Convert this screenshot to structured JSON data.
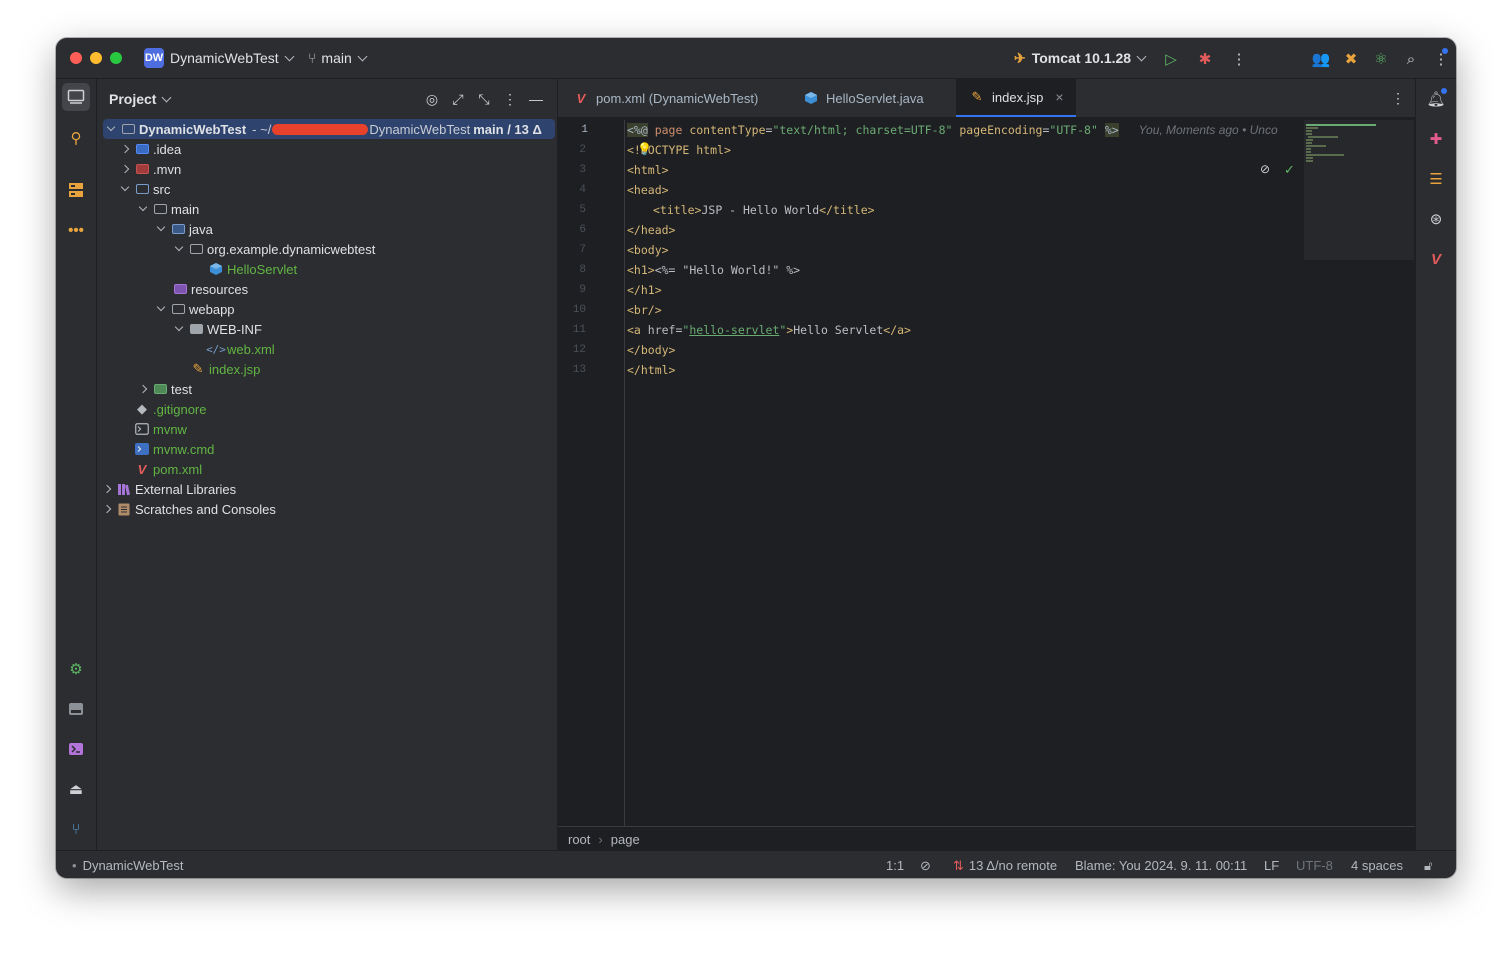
{
  "titlebar": {
    "project_badge": "DW",
    "project_name": "DynamicWebTest",
    "branch": "main",
    "run_config": "Tomcat 10.1.28"
  },
  "project_panel": {
    "title": "Project",
    "root": {
      "name": "DynamicWebTest",
      "path_prefix": "- ~/",
      "path_suffix": "DynamicWebTest",
      "vcs": "main / 13 Δ"
    },
    "items": [
      {
        "label": ".idea"
      },
      {
        "label": ".mvn"
      },
      {
        "label": "src"
      },
      {
        "label": "main"
      },
      {
        "label": "java"
      },
      {
        "label": "org.example.dynamicwebtest"
      },
      {
        "label": "HelloServlet"
      },
      {
        "label": "resources"
      },
      {
        "label": "webapp"
      },
      {
        "label": "WEB-INF"
      },
      {
        "label": "web.xml"
      },
      {
        "label": "index.jsp"
      },
      {
        "label": "test"
      },
      {
        "label": ".gitignore"
      },
      {
        "label": "mvnw"
      },
      {
        "label": "mvnw.cmd"
      },
      {
        "label": "pom.xml"
      },
      {
        "label": "External Libraries"
      },
      {
        "label": "Scratches and Consoles"
      }
    ]
  },
  "tabs": [
    {
      "label": "pom.xml (DynamicWebTest)"
    },
    {
      "label": "HelloServlet.java"
    },
    {
      "label": "index.jsp",
      "close": "×"
    }
  ],
  "editor": {
    "line_numbers": [
      "1",
      "2",
      "3",
      "4",
      "5",
      "6",
      "7",
      "8",
      "9",
      "10",
      "11",
      "12",
      "13"
    ],
    "line1": {
      "open": "<%@",
      "page": " page ",
      "a1": "contentType",
      "v1": "\"text/html; charset=UTF-8\"",
      "a2": " pageEncoding",
      "v2": "\"UTF-8\"",
      "close": "%>",
      "blame": "You, Moments ago • Unco"
    },
    "line2": {
      "open": "<!",
      "rest": "DOCTYPE html",
      "close": ">"
    },
    "line3": "<html>",
    "line4": "<head>",
    "line5": {
      "open": "<title>",
      "text": "JSP - Hello World",
      "close": "</title>"
    },
    "line6": "</head>",
    "line7": "<body>",
    "line8": {
      "open": "<h1>",
      "expr": "<%= \"Hello World!\" %>"
    },
    "line9": "</h1>",
    "line10": "<br/>",
    "line11": {
      "open": "<a",
      "attr": " href",
      "eq": "=",
      "q1": "\"",
      "link": "hello-servlet",
      "q2": "\"",
      "gt": ">",
      "text": "Hello Servlet",
      "close": "</a>"
    },
    "line12": "</body>",
    "line13": "</html>"
  },
  "breadcrumbs": {
    "root": "root",
    "sep": "›",
    "page": "page"
  },
  "statusbar": {
    "project": "DynamicWebTest",
    "position": "1:1",
    "vcs": "13 Δ/no remote",
    "blame": "Blame: You 2024. 9. 11. 00:11",
    "line_ending": "LF",
    "encoding": "UTF-8",
    "indent": "4 spaces"
  },
  "colors": {
    "accent": "#3574f0",
    "redaction": "#e8412c"
  }
}
